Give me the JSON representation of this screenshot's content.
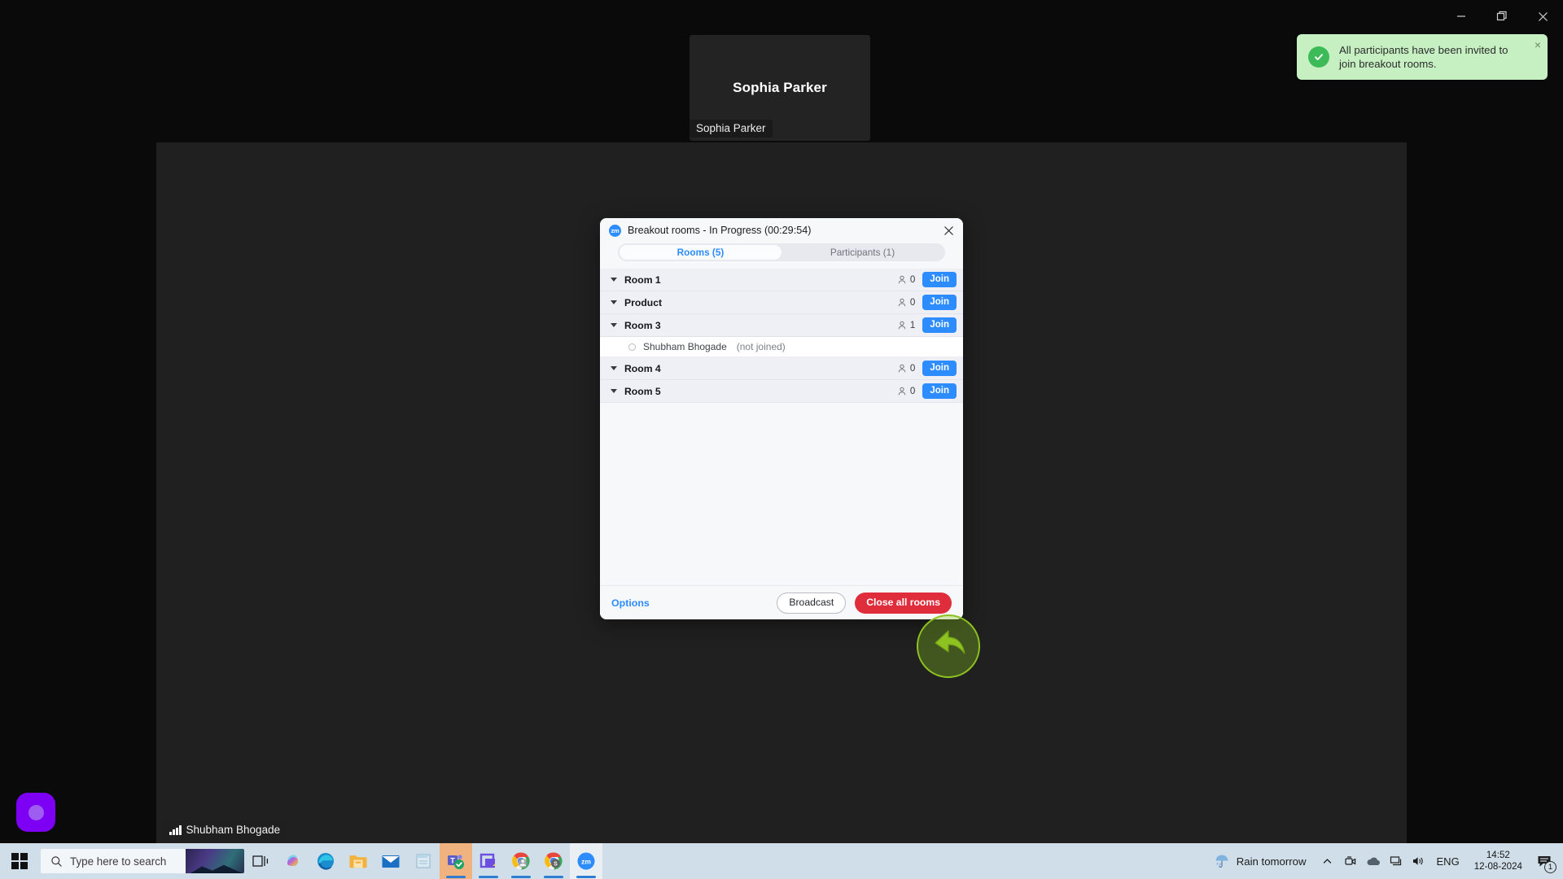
{
  "window_controls": {
    "minimize": "minimize-icon",
    "restore": "restore-icon",
    "close": "close-icon"
  },
  "video_tile": {
    "display_name": "Sophia Parker",
    "name_badge": "Sophia Parker"
  },
  "stage": {
    "self_name_badge": "Shubham Bhogade"
  },
  "toast": {
    "message": "All participants have been invited to join breakout rooms.",
    "icon": "check-circle-icon",
    "close": "×",
    "bg_color": "#c6f0c2",
    "icon_color": "#3dbb58"
  },
  "dialog": {
    "logo_text": "zm",
    "title": "Breakout rooms - In Progress (00:29:54)",
    "close_label": "close-icon",
    "tabs": [
      {
        "label": "Rooms (5)",
        "active": true
      },
      {
        "label": "Participants (1)",
        "active": false
      }
    ],
    "rooms": [
      {
        "name": "Room 1",
        "count": "0",
        "join_label": "Join"
      },
      {
        "name": "Product",
        "count": "0",
        "join_label": "Join"
      },
      {
        "name": "Room 3",
        "count": "1",
        "join_label": "Join",
        "participants": [
          {
            "name": "Shubham Bhogade",
            "state": "(not joined)"
          }
        ]
      },
      {
        "name": "Room 4",
        "count": "0",
        "join_label": "Join"
      },
      {
        "name": "Room 5",
        "count": "0",
        "join_label": "Join"
      }
    ],
    "footer": {
      "options_label": "Options",
      "broadcast_label": "Broadcast",
      "close_all_label": "Close all rooms"
    },
    "accent_color": "#2d8cff",
    "danger_color": "#e02d3c"
  },
  "cursor": {
    "highlight_color": "#8ec220"
  },
  "taskbar": {
    "start_label": "start-button",
    "search_placeholder": "Type here to search",
    "items": [
      {
        "name": "task-view",
        "icon": "task-view-icon"
      },
      {
        "name": "copilot",
        "icon": "copilot-icon"
      },
      {
        "name": "edge",
        "icon": "edge-icon"
      },
      {
        "name": "file-explorer",
        "icon": "folder-icon"
      },
      {
        "name": "mail",
        "icon": "mail-icon"
      },
      {
        "name": "notepad",
        "icon": "notepad-icon"
      },
      {
        "name": "teams",
        "icon": "teams-icon"
      },
      {
        "name": "media-app",
        "icon": "media-icon"
      },
      {
        "name": "chrome-profile-1",
        "icon": "chrome-icon"
      },
      {
        "name": "chrome-profile-2",
        "icon": "chrome-icon"
      },
      {
        "name": "zoom",
        "icon": "zoom-icon"
      }
    ],
    "weather_text": "Rain tomorrow",
    "language": "ENG",
    "time": "14:52",
    "date": "12-08-2024",
    "notification_count": "1"
  }
}
